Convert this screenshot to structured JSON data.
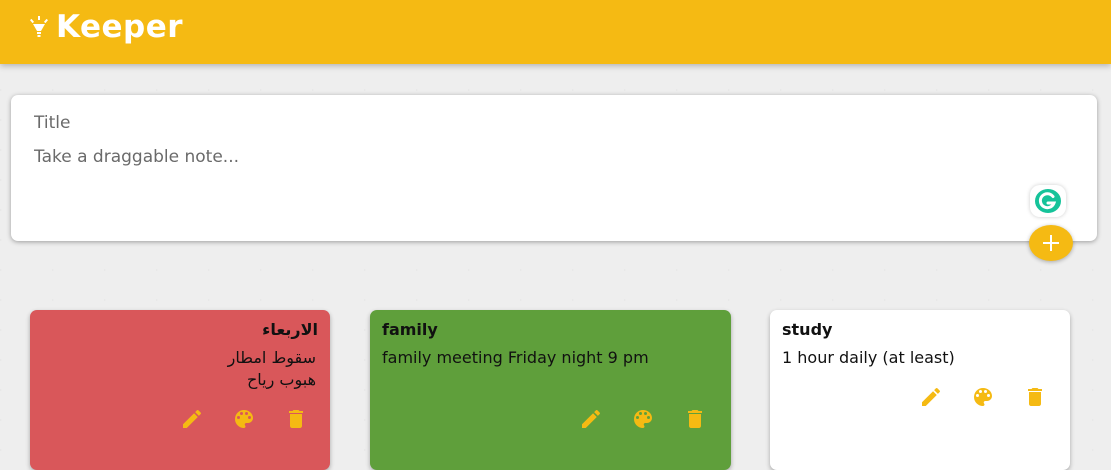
{
  "app": {
    "name": "Keeper"
  },
  "colors": {
    "accent": "#f5ba13",
    "note_red": "#d9575a",
    "note_green": "#5f9f3b",
    "note_white": "#ffffff"
  },
  "composer": {
    "title_placeholder": "Title",
    "body_placeholder": "Take a draggable note..."
  },
  "notes": [
    {
      "title": "الاربعاء",
      "content": "سقوط امطار\nهبوب رياح",
      "color": "#d9575a",
      "direction": "rtl"
    },
    {
      "title": "family",
      "content": "family meeting Friday night 9 pm",
      "color": "#5f9f3b",
      "direction": "ltr"
    },
    {
      "title": "study",
      "content": "1 hour daily (at least)",
      "color": "#ffffff",
      "direction": "ltr"
    }
  ],
  "icons": {
    "logo": "lightbulb-icon",
    "add": "plus-icon",
    "edit": "pencil-icon",
    "color": "palette-icon",
    "delete": "trash-icon",
    "extension": "grammarly-icon"
  }
}
